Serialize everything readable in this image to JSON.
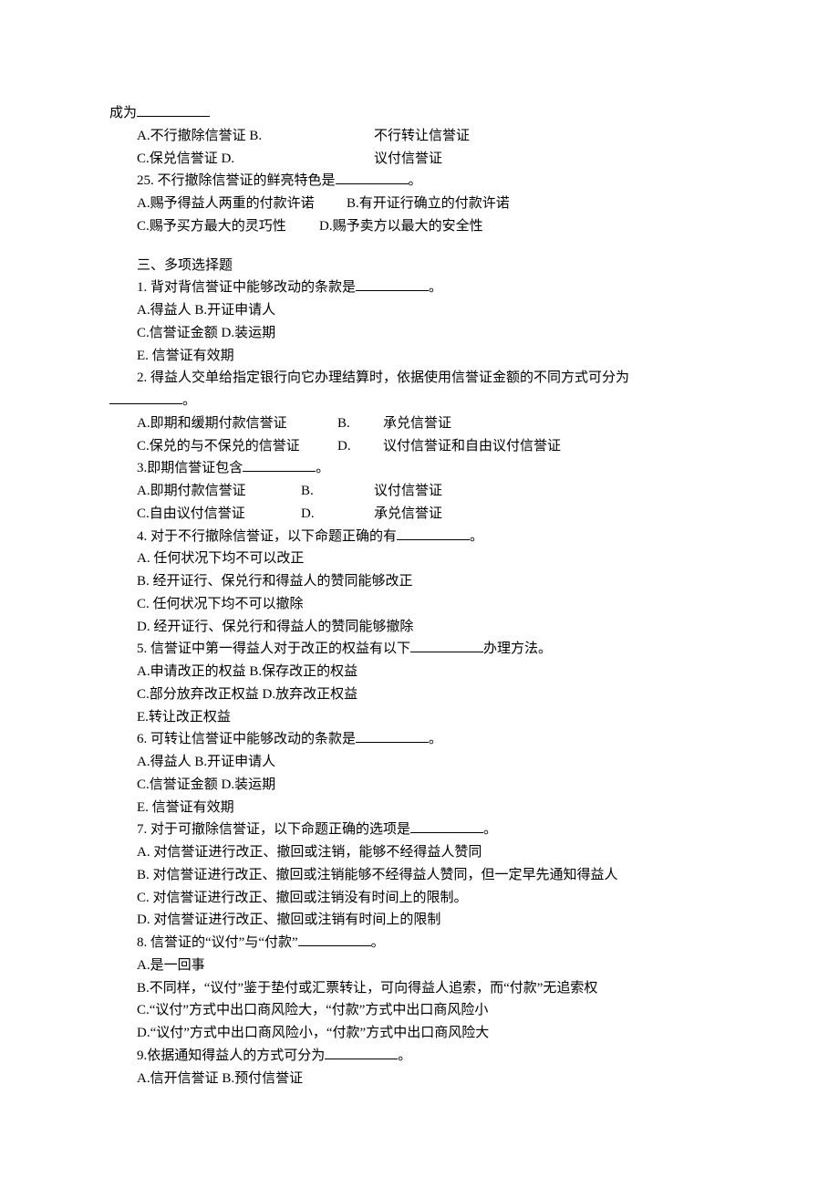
{
  "intro": {
    "prefix": "成为",
    "optA": "A.不行撤除信誉证 B.",
    "optA_r": "不行转让信誉证",
    "optC": "C.保兑信誉证 D.",
    "optC_r": "议付信誉证"
  },
  "q25": {
    "stem_pre": "25. 不行撤除信誉证的鲜亮特色是",
    "stem_post": "。",
    "rowA_l": "A.赐予得益人两重的付款许诺",
    "rowA_r": "B.有开证行确立的付款许诺",
    "rowC_l": "C.赐予买方最大的灵巧性",
    "rowC_r": "D.赐予卖方以最大的安全性"
  },
  "section3": "三、多项选择题",
  "m1": {
    "stem_pre": "1. 背对背信誉证中能够改动的条款是",
    "stem_post": "。",
    "a": "A.得益人 B.开证申请人",
    "c": "C.信誉证金额 D.装运期",
    "e": "E. 信誉证有效期"
  },
  "m2": {
    "stem": "2. 得益人交单给指定银行向它办理结算时，依据使用信誉证金额的不同方式可分为",
    "stem_post": "。",
    "rowA_l": "A.即期和缓期付款信誉证",
    "rowA_m": "B.",
    "rowA_r": "承兑信誉证",
    "rowC_l": "C.保兑的与不保兑的信誉证",
    "rowC_m": "D.",
    "rowC_r": "议付信誉证和自由议付信誉证"
  },
  "m3": {
    "stem_pre": "3.即期信誉证包含",
    "stem_post": "。",
    "rowA_l": "A.即期付款信誉证",
    "rowA_m": "B.",
    "rowA_r": "议付信誉证",
    "rowC_l": "C.自由议付信誉证",
    "rowC_m": "D.",
    "rowC_r": "承兑信誉证"
  },
  "m4": {
    "stem_pre": "4. 对于不行撤除信誉证，以下命题正确的有",
    "stem_post": "。",
    "a": "A. 任何状况下均不可以改正",
    "b": "B. 经开证行、保兑行和得益人的赞同能够改正",
    "c": "C. 任何状况下均不可以撤除",
    "d": "D. 经开证行、保兑行和得益人的赞同能够撤除"
  },
  "m5": {
    "stem_pre": "5. 信誉证中第一得益人对于改正的权益有以下",
    "stem_post": "办理方法。",
    "a": "A.申请改正的权益 B.保存改正的权益",
    "c": "C.部分放弃改正权益 D.放弃改正权益",
    "e": "E.转让改正权益"
  },
  "m6": {
    "stem_pre": "6. 可转让信誉证中能够改动的条款是",
    "stem_post": "。",
    "a": "A.得益人 B.开证申请人",
    "c": "C.信誉证金额 D.装运期",
    "e": "E. 信誉证有效期"
  },
  "m7": {
    "stem_pre": "7. 对于可撤除信誉证，以下命题正确的选项是",
    "stem_post": "。",
    "a": "A. 对信誉证进行改正、撤回或注销，能够不经得益人赞同",
    "b": "B. 对信誉证进行改正、撤回或注销能够不经得益人赞同，但一定早先通知得益人",
    "c": "C. 对信誉证进行改正、撤回或注销没有时间上的限制。",
    "d": "D. 对信誉证进行改正、撤回或注销有时间上的限制"
  },
  "m8": {
    "stem_pre": "8. 信誉证的“议付”与“付款”",
    "stem_post": "。",
    "a": "A.是一回事",
    "b": "B.不同样，“议付”鉴于垫付或汇票转让，可向得益人追索，而“付款”无追索权",
    "c": "C.“议付”方式中出口商风险大，“付款”方式中出口商风险小",
    "d": "D.“议付”方式中出口商风险小，“付款”方式中出口商风险大"
  },
  "m9": {
    "stem_pre": "9.依据通知得益人的方式可分为",
    "stem_post": "。",
    "a": "A.信开信誉证 B.预付信誉证"
  }
}
